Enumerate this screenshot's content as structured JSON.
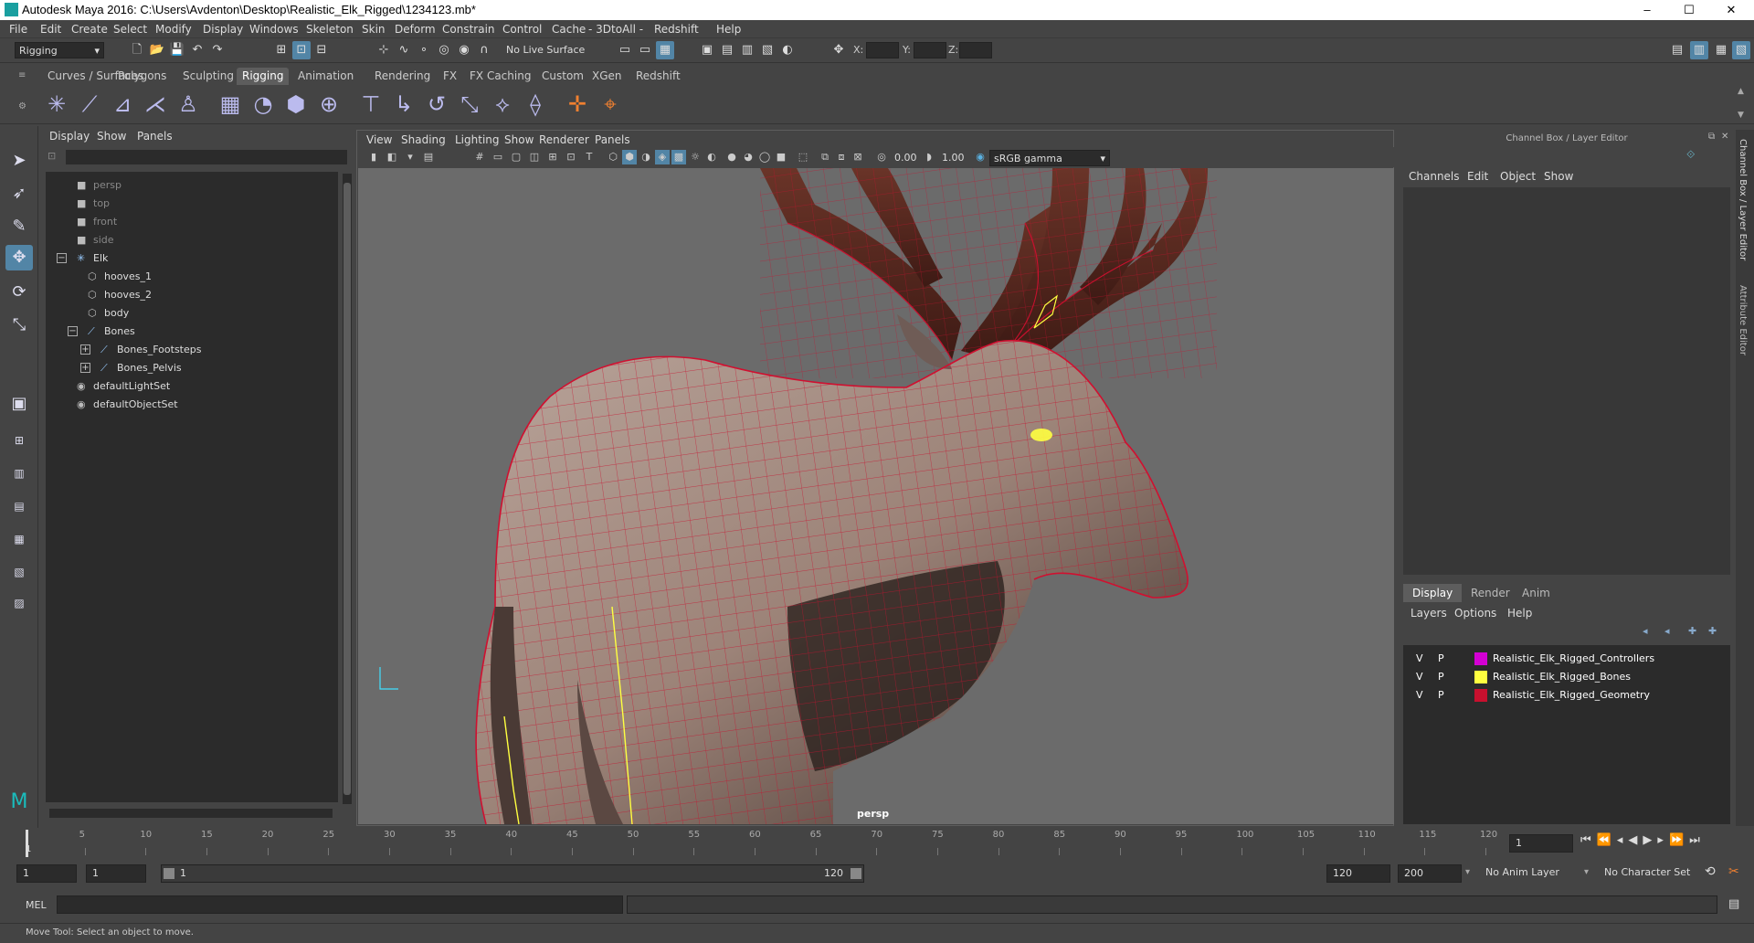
{
  "window": {
    "title": "Autodesk Maya 2016: C:\\Users\\Avdenton\\Desktop\\Realistic_Elk_Rigged\\1234123.mb*",
    "min": "–",
    "max": "☐",
    "close": "✕"
  },
  "menubar": [
    "File",
    "Edit",
    "Create",
    "Select",
    "Modify",
    "Display",
    "Windows",
    "Skeleton",
    "Skin",
    "Deform",
    "Constrain",
    "Control",
    "Cache",
    "- 3DtoAll -",
    "Redshift",
    "Help"
  ],
  "statusline": {
    "mode": "Rigging",
    "live_surface": "No Live Surface",
    "x_label": "X:",
    "y_label": "Y:",
    "z_label": "Z:"
  },
  "shelf_tabs": [
    "Curves / Surfaces",
    "Polygons",
    "Sculpting",
    "Rigging",
    "Animation",
    "Rendering",
    "FX",
    "FX Caching",
    "Custom",
    "XGen",
    "Redshift"
  ],
  "shelf_active": "Rigging",
  "outliner": {
    "menu": [
      "Display",
      "Show",
      "Panels"
    ],
    "items": [
      {
        "label": "persp",
        "indent": 0,
        "dim": true,
        "icon": "camera-icon"
      },
      {
        "label": "top",
        "indent": 0,
        "dim": true,
        "icon": "camera-icon"
      },
      {
        "label": "front",
        "indent": 0,
        "dim": true,
        "icon": "camera-icon"
      },
      {
        "label": "side",
        "indent": 0,
        "dim": true,
        "icon": "camera-icon"
      },
      {
        "label": "Elk",
        "indent": 0,
        "dim": false,
        "icon": "joint-icon",
        "exp": "−"
      },
      {
        "label": "hooves_1",
        "indent": 1,
        "dim": false,
        "icon": "mesh-icon"
      },
      {
        "label": "hooves_2",
        "indent": 1,
        "dim": false,
        "icon": "mesh-icon"
      },
      {
        "label": "body",
        "indent": 1,
        "dim": false,
        "icon": "mesh-icon"
      },
      {
        "label": "Bones",
        "indent": 1,
        "dim": false,
        "icon": "bone-icon",
        "exp": "−"
      },
      {
        "label": "Bones_Footsteps",
        "indent": 2,
        "dim": false,
        "icon": "bone-icon",
        "exp": "+"
      },
      {
        "label": "Bones_Pelvis",
        "indent": 2,
        "dim": false,
        "icon": "bone-icon",
        "exp": "+"
      },
      {
        "label": "defaultLightSet",
        "indent": 0,
        "dim": false,
        "icon": "set-icon"
      },
      {
        "label": "defaultObjectSet",
        "indent": 0,
        "dim": false,
        "icon": "set-icon"
      }
    ]
  },
  "viewport": {
    "menu": [
      "View",
      "Shading",
      "Lighting",
      "Show",
      "Renderer",
      "Panels"
    ],
    "exposure": "0.00",
    "gamma": "1.00",
    "color_space": "sRGB gamma",
    "camera_label": "persp"
  },
  "channel_box": {
    "title": "Channel Box / Layer Editor",
    "menu": [
      "Channels",
      "Edit",
      "Object",
      "Show"
    ]
  },
  "layer_editor": {
    "tabs": [
      "Display",
      "Render",
      "Anim"
    ],
    "active_tab": "Display",
    "menu": [
      "Layers",
      "Options",
      "Help"
    ],
    "layers": [
      {
        "v": "V",
        "p": "P",
        "color": "#d400d4",
        "name": "Realistic_Elk_Rigged_Controllers"
      },
      {
        "v": "V",
        "p": "P",
        "color": "#ffff40",
        "name": "Realistic_Elk_Rigged_Bones"
      },
      {
        "v": "V",
        "p": "P",
        "color": "#c8102e",
        "name": "Realistic_Elk_Rigged_Geometry"
      }
    ]
  },
  "side_tabs": [
    "Channel Box / Layer Editor",
    "Attribute Editor"
  ],
  "timeline": {
    "ticks": [
      "5",
      "10",
      "15",
      "20",
      "25",
      "30",
      "35",
      "40",
      "45",
      "50",
      "55",
      "60",
      "65",
      "70",
      "75",
      "80",
      "85",
      "90",
      "95",
      "100",
      "105",
      "110",
      "115",
      "120"
    ],
    "start_marker": "1",
    "current_frame": "1"
  },
  "range": {
    "start": "1",
    "playback_start": "1",
    "range_start_label": "1",
    "range_end_label": "120",
    "playback_end": "120",
    "end": "200",
    "anim_layer": "No Anim Layer",
    "character_set": "No Character Set"
  },
  "command": {
    "label": "MEL"
  },
  "help_line": "Move Tool: Select an object to move.",
  "colors": {
    "accent": "#5285a6",
    "wire": "#c8102e"
  }
}
